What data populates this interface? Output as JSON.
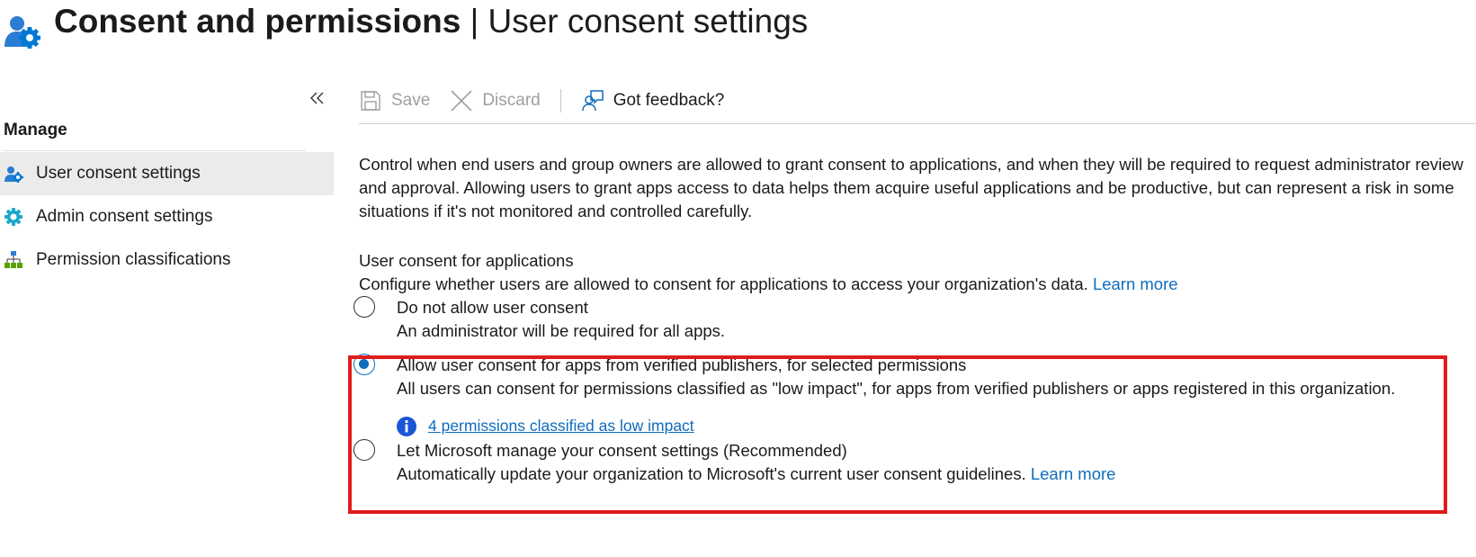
{
  "header": {
    "icon": "user-gear-icon",
    "title_main": "Consent and permissions",
    "title_separator": "|",
    "title_sub": "User consent settings",
    "more": "···"
  },
  "sidebar": {
    "collapse_icon": "double-chevron-left-icon",
    "heading": "Manage",
    "items": [
      {
        "label": "User consent settings",
        "icon": "user-gear-icon",
        "active": true
      },
      {
        "label": "Admin consent settings",
        "icon": "gear-icon",
        "active": false
      },
      {
        "label": "Permission classifications",
        "icon": "hierarchy-icon",
        "active": false
      }
    ]
  },
  "toolbar": {
    "save_label": "Save",
    "discard_label": "Discard",
    "feedback_label": "Got feedback?"
  },
  "main": {
    "description": "Control when end users and group owners are allowed to grant consent to applications, and when they will be required to request administrator review and approval. Allowing users to grant apps access to data helps them acquire useful applications and be productive, but can represent a risk in some situations if it's not monitored and controlled carefully.",
    "section_title": "User consent for applications",
    "section_desc": "Configure whether users are allowed to consent for applications to access your organization's data.",
    "section_learn_more": "Learn more",
    "options": [
      {
        "label": "Do not allow user consent",
        "desc": "An administrator will be required for all apps.",
        "checked": false
      },
      {
        "label": "Allow user consent for apps from verified publishers, for selected permissions",
        "desc": "All users can consent for permissions classified as \"low impact\", for apps from verified publishers or apps registered in this organization.",
        "info_link": "4 permissions classified as low impact",
        "checked": true
      },
      {
        "label": "Let Microsoft manage your consent settings (Recommended)",
        "desc": "Automatically update your organization to Microsoft's current user consent guidelines.",
        "learn_more": "Learn more",
        "checked": false
      }
    ]
  },
  "colors": {
    "accent": "#0f6cbd",
    "highlight": "#e01b1b",
    "active_nav": "#edebe9",
    "disabled_text": "#a19f9d"
  }
}
